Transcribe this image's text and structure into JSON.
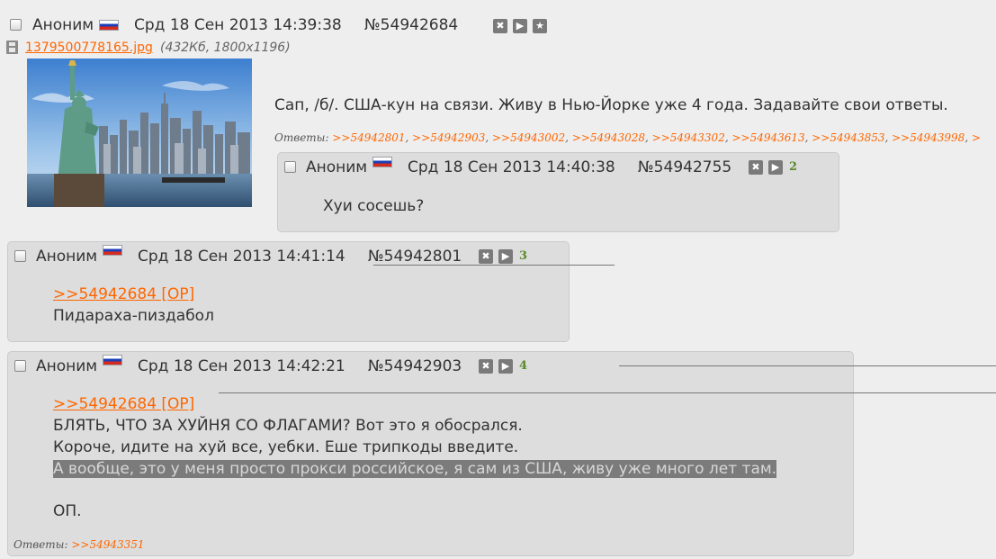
{
  "op": {
    "name": "Аноним",
    "date": "Срд 18 Сен 2013 14:39:38",
    "number": "№54942684",
    "file": {
      "name": "1379500778165.jpg",
      "info": "(432Кб, 1800x1196)"
    },
    "text": "Сап, /б/. США-кун на связи. Живу в Нью-Йорке уже 4 года. Задавайте свои ответы.",
    "replies_label": "Ответы:",
    "replies": [
      ">>54942801",
      ">>54942903",
      ">>54943002",
      ">>54943028",
      ">>54943302",
      ">>54943613",
      ">>54943853",
      ">>54943998",
      ">"
    ]
  },
  "posts": [
    {
      "name": "Аноним",
      "date": "Срд 18 Сен 2013 14:40:38",
      "number": "№54942755",
      "count": "2",
      "lines": [
        "Хуи сосешь?"
      ]
    },
    {
      "name": "Аноним",
      "date": "Срд 18 Сен 2013 14:41:14",
      "number": "№54942801",
      "count": "3",
      "quote": ">>54942684 [OP]",
      "lines": [
        "Пидараха-пиздабол"
      ]
    },
    {
      "name": "Аноним",
      "date": "Срд 18 Сен 2013 14:42:21",
      "number": "№54942903",
      "count": "4",
      "quote": ">>54942684 [OP]",
      "lines": [
        "БЛЯТЬ, ЧТО ЗА ХУЙНЯ СО ФЛАГАМИ? Вот это я обосрался.",
        "Короче, идите на хуй все, уебки. Еше трипкоды введите.",
        "А вообще, это у меня просто прокси российское, я сам из США, живу уже много лет там.",
        "ОП."
      ],
      "replies_label": "Ответы:",
      "replies": [
        ">>54943351"
      ]
    }
  ],
  "buttons": {
    "hide": "✖",
    "play": "▶",
    "fav": "★"
  },
  "colors": {
    "link": "#ff6600",
    "post_bg": "#dddddd",
    "page_bg": "#eeeeee",
    "reply_count": "#5a8a2a"
  },
  "icons": [
    "checkbox",
    "russia-flag-icon",
    "hide-icon",
    "play-icon",
    "star-icon",
    "file-icon"
  ]
}
